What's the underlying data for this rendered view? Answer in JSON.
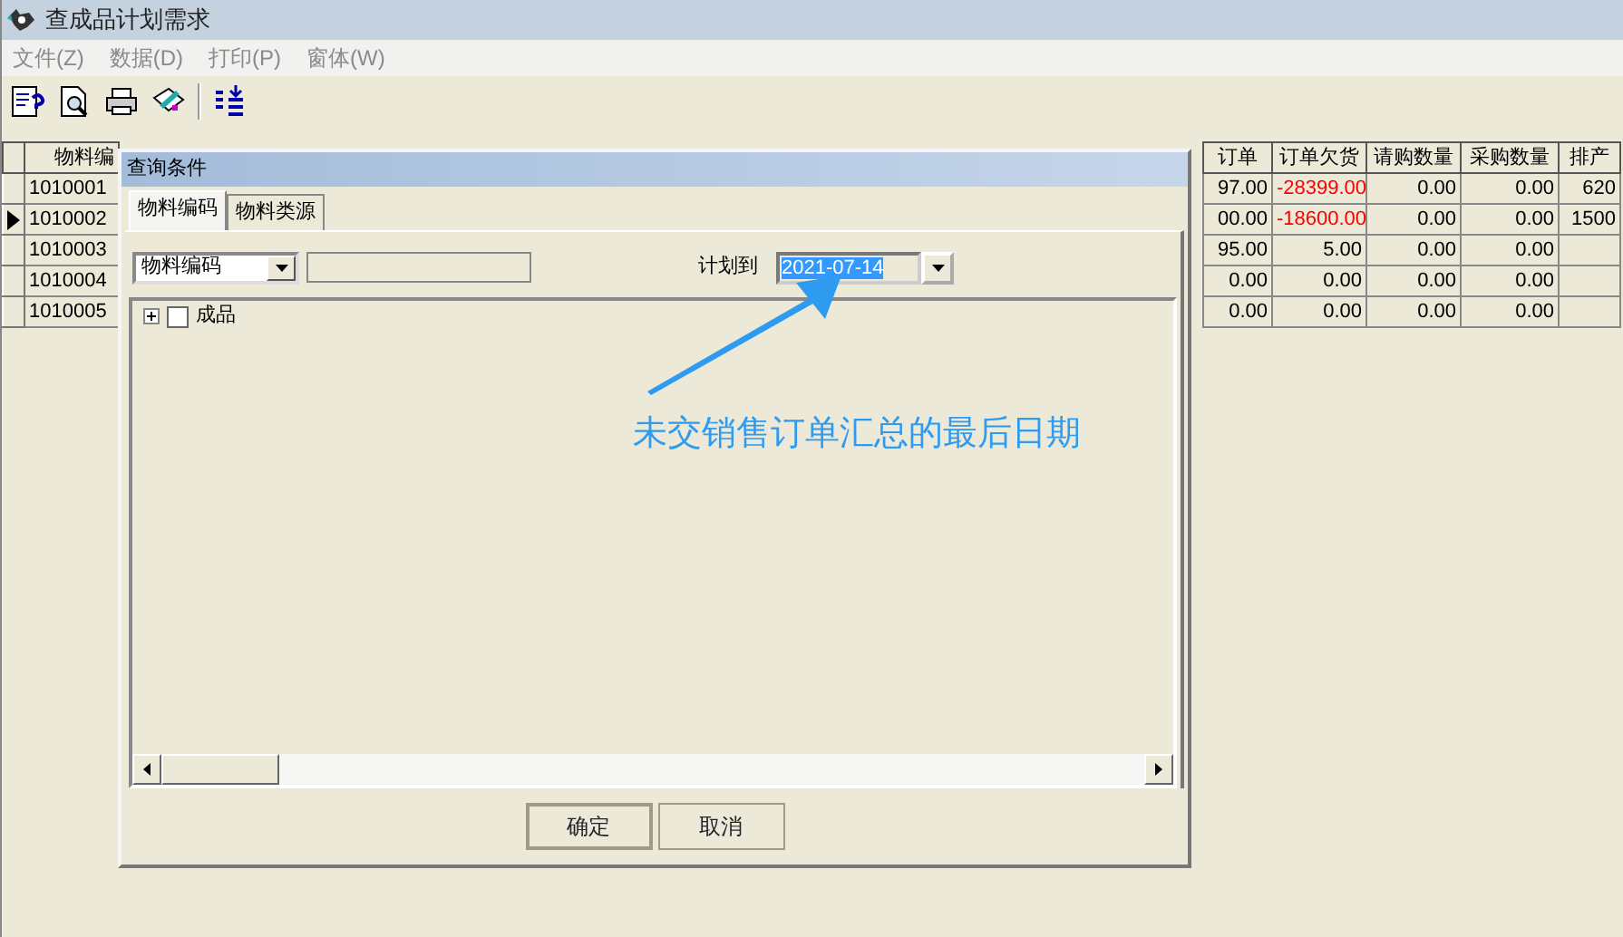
{
  "window": {
    "title": "查成品计划需求"
  },
  "menu": [
    {
      "label": "文件(Z)",
      "disabled": true
    },
    {
      "label": "数据(D)",
      "disabled": true
    },
    {
      "label": "打印(P)",
      "disabled": true
    },
    {
      "label": "窗体(W)",
      "disabled": true
    }
  ],
  "toolbar": [
    {
      "kind": "query"
    },
    {
      "kind": "preview"
    },
    {
      "kind": "print"
    },
    {
      "kind": "edit"
    },
    {
      "kind": "separator"
    },
    {
      "kind": "list"
    }
  ],
  "grid": {
    "columns": [
      {
        "label": "物料编"
      },
      {
        "label": "订单"
      },
      {
        "label": "订单欠货"
      },
      {
        "label": "请购数量"
      },
      {
        "label": "采购数量"
      },
      {
        "label": "排产"
      }
    ],
    "rows": [
      {
        "selected": false,
        "cells": [
          {
            "text": "1010001"
          },
          {
            "text": "97.00"
          },
          {
            "text": "-28399.00",
            "warning": true
          },
          {
            "text": "0.00"
          },
          {
            "text": "0.00"
          },
          {
            "text": "620"
          }
        ]
      },
      {
        "selected": true,
        "cells": [
          {
            "text": "1010002"
          },
          {
            "text": "00.00"
          },
          {
            "text": "-18600.00",
            "warning": true
          },
          {
            "text": "0.00"
          },
          {
            "text": "0.00"
          },
          {
            "text": "1500"
          }
        ]
      },
      {
        "selected": false,
        "cells": [
          {
            "text": "1010003"
          },
          {
            "text": "95.00"
          },
          {
            "text": "5.00"
          },
          {
            "text": "0.00"
          },
          {
            "text": "0.00"
          }
        ]
      },
      {
        "selected": false,
        "cells": [
          {
            "text": "1010004"
          },
          {
            "text": "0.00"
          },
          {
            "text": "0.00"
          },
          {
            "text": "0.00"
          },
          {
            "text": "0.00"
          }
        ]
      },
      {
        "selected": false,
        "cells": [
          {
            "text": "1010005"
          },
          {
            "text": "0.00"
          },
          {
            "text": "0.00"
          },
          {
            "text": "0.00"
          },
          {
            "text": "0.00"
          }
        ]
      }
    ]
  },
  "dialog": {
    "title": "查询条件",
    "tabs": [
      {
        "label": "物料编码",
        "selected": true
      },
      {
        "label": "物料类源",
        "selected": false
      }
    ],
    "field_select": {
      "value": "物料编码"
    },
    "plan_label": "计划到",
    "date_field": {
      "value": "2021-07-14",
      "text_selected": true
    },
    "tree": [
      {
        "label": "成品",
        "expanded": false,
        "checked": false
      }
    ],
    "buttons": [
      {
        "label": "确定",
        "default": true
      },
      {
        "label": "取消",
        "default": false
      }
    ]
  },
  "annotation": {
    "text": "未交销售订单汇总的最后日期"
  }
}
